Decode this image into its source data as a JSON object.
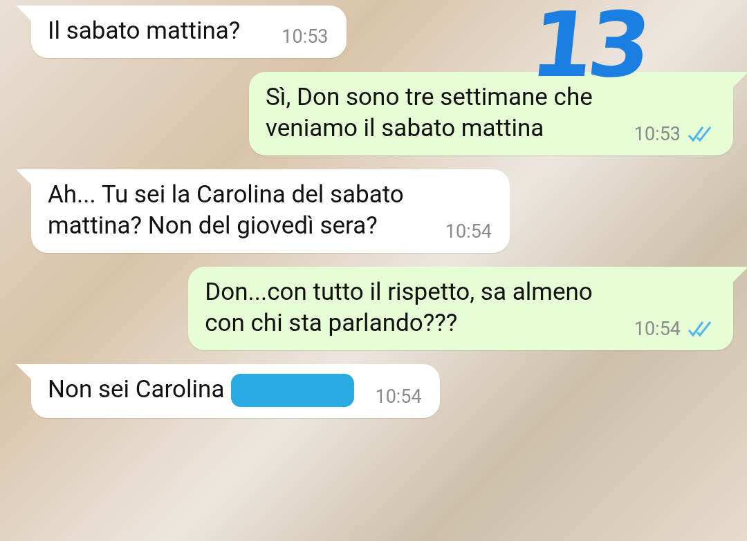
{
  "annotation": {
    "text": "13"
  },
  "messages": [
    {
      "kind": "incoming",
      "text": "Il sabato mattina?",
      "time": "10:53",
      "redacted": false
    },
    {
      "kind": "outgoing",
      "text": "Sì, Don sono tre settimane che\nveniamo il sabato mattina",
      "time": "10:53",
      "read": true,
      "redacted": false
    },
    {
      "kind": "incoming",
      "text": "Ah... Tu sei la Carolina del sabato\nmattina? Non del giovedì sera?",
      "time": "10:54",
      "redacted": false
    },
    {
      "kind": "outgoing",
      "text": "Don...con tutto il rispetto, sa almeno\ncon chi sta parlando???",
      "time": "10:54",
      "read": true,
      "redacted": false
    },
    {
      "kind": "incoming",
      "text": "Non sei Carolina",
      "time": "10:54",
      "redacted": true
    }
  ]
}
